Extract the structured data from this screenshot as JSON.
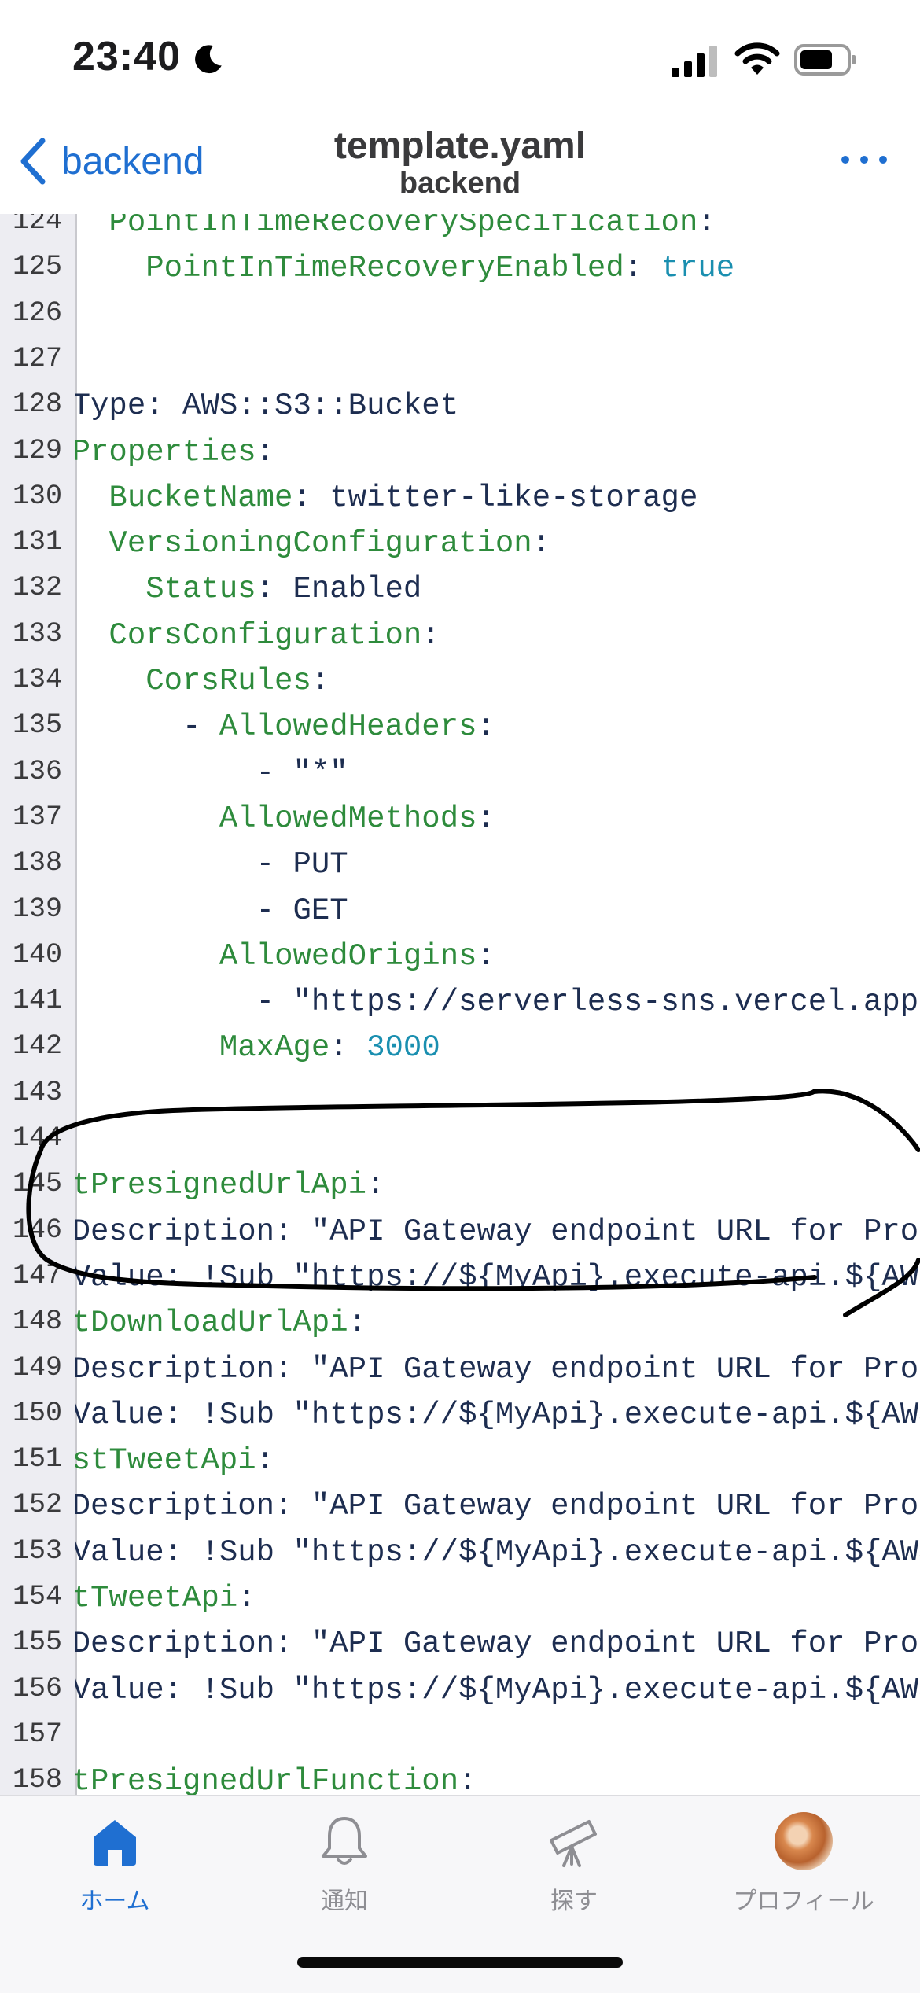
{
  "status_bar": {
    "time": "23:40"
  },
  "nav": {
    "back_label": "backend",
    "title": "template.yaml",
    "subtitle": "backend"
  },
  "code_lines": [
    {
      "num": "124",
      "tokens": [
        {
          "t": "      PointInTimeRecoverySpecification",
          "c": "k"
        },
        {
          "t": ":",
          "c": ""
        }
      ]
    },
    {
      "num": "125",
      "tokens": [
        {
          "t": "        PointInTimeRecoveryEnabled",
          "c": "k"
        },
        {
          "t": ": ",
          "c": ""
        },
        {
          "t": "true",
          "c": "v"
        }
      ]
    },
    {
      "num": "126",
      "tokens": []
    },
    {
      "num": "127",
      "tokens": []
    },
    {
      "num": "128",
      "tokens": [
        {
          "t": "    Type: AWS::S3::Bucket",
          "c": ""
        }
      ]
    },
    {
      "num": "129",
      "tokens": [
        {
          "t": "    Properties",
          "c": "k"
        },
        {
          "t": ":",
          "c": ""
        }
      ]
    },
    {
      "num": "130",
      "tokens": [
        {
          "t": "      BucketName",
          "c": "k"
        },
        {
          "t": ": twitter-like-storage",
          "c": ""
        }
      ]
    },
    {
      "num": "131",
      "tokens": [
        {
          "t": "      VersioningConfiguration",
          "c": "k"
        },
        {
          "t": ":",
          "c": ""
        }
      ]
    },
    {
      "num": "132",
      "tokens": [
        {
          "t": "        Status",
          "c": "k"
        },
        {
          "t": ": Enabled",
          "c": ""
        }
      ]
    },
    {
      "num": "133",
      "tokens": [
        {
          "t": "      CorsConfiguration",
          "c": "k"
        },
        {
          "t": ":",
          "c": ""
        }
      ]
    },
    {
      "num": "134",
      "tokens": [
        {
          "t": "        CorsRules",
          "c": "k"
        },
        {
          "t": ":",
          "c": ""
        }
      ]
    },
    {
      "num": "135",
      "tokens": [
        {
          "t": "          - ",
          "c": ""
        },
        {
          "t": "AllowedHeaders",
          "c": "k"
        },
        {
          "t": ":",
          "c": ""
        }
      ]
    },
    {
      "num": "136",
      "tokens": [
        {
          "t": "              - \"*\"",
          "c": ""
        }
      ]
    },
    {
      "num": "137",
      "tokens": [
        {
          "t": "            ",
          "c": ""
        },
        {
          "t": "AllowedMethods",
          "c": "k"
        },
        {
          "t": ":",
          "c": ""
        }
      ]
    },
    {
      "num": "138",
      "tokens": [
        {
          "t": "              - PUT",
          "c": ""
        }
      ]
    },
    {
      "num": "139",
      "tokens": [
        {
          "t": "              - GET",
          "c": ""
        }
      ]
    },
    {
      "num": "140",
      "tokens": [
        {
          "t": "            ",
          "c": ""
        },
        {
          "t": "AllowedOrigins",
          "c": "k"
        },
        {
          "t": ":",
          "c": ""
        }
      ]
    },
    {
      "num": "141",
      "tokens": [
        {
          "t": "              - \"https://serverless-sns.vercel.app\"",
          "c": ""
        }
      ]
    },
    {
      "num": "142",
      "tokens": [
        {
          "t": "            ",
          "c": ""
        },
        {
          "t": "MaxAge",
          "c": "k"
        },
        {
          "t": ": ",
          "c": ""
        },
        {
          "t": "3000",
          "c": "v"
        }
      ]
    },
    {
      "num": "143",
      "tokens": []
    },
    {
      "num": "144",
      "tokens": []
    },
    {
      "num": "145",
      "tokens": [
        {
          "t": "  GetPresignedUrlApi",
          "c": "k"
        },
        {
          "t": ":",
          "c": ""
        }
      ]
    },
    {
      "num": "146",
      "tokens": [
        {
          "t": "    Description: \"API Gateway endpoint URL for Prod stage",
          "c": ""
        }
      ]
    },
    {
      "num": "147",
      "tokens": [
        {
          "t": "    Value: !Sub \"https://${MyApi}.execute-api.${AWS::Region",
          "c": ""
        }
      ]
    },
    {
      "num": "148",
      "tokens": [
        {
          "t": "  GetDownloadUrlApi",
          "c": "k"
        },
        {
          "t": ":",
          "c": ""
        }
      ]
    },
    {
      "num": "149",
      "tokens": [
        {
          "t": "    Description: \"API Gateway endpoint URL for Prod stage",
          "c": ""
        }
      ]
    },
    {
      "num": "150",
      "tokens": [
        {
          "t": "    Value: !Sub \"https://${MyApi}.execute-api.${AWS::Region",
          "c": ""
        }
      ]
    },
    {
      "num": "151",
      "tokens": [
        {
          "t": "  PostTweetApi",
          "c": "k"
        },
        {
          "t": ":",
          "c": ""
        }
      ]
    },
    {
      "num": "152",
      "tokens": [
        {
          "t": "    Description: \"API Gateway endpoint URL for Prod stage",
          "c": ""
        }
      ]
    },
    {
      "num": "153",
      "tokens": [
        {
          "t": "    Value: !Sub \"https://${MyApi}.execute-api.${AWS::Region",
          "c": ""
        }
      ]
    },
    {
      "num": "154",
      "tokens": [
        {
          "t": "  GetTweetApi",
          "c": "k"
        },
        {
          "t": ":",
          "c": ""
        }
      ]
    },
    {
      "num": "155",
      "tokens": [
        {
          "t": "    Description: \"API Gateway endpoint URL for Prod stage",
          "c": ""
        }
      ]
    },
    {
      "num": "156",
      "tokens": [
        {
          "t": "    Value: !Sub \"https://${MyApi}.execute-api.${AWS::Region",
          "c": ""
        }
      ]
    },
    {
      "num": "157",
      "tokens": []
    },
    {
      "num": "158",
      "tokens": [
        {
          "t": "  GetPresignedUrlFunction",
          "c": "k"
        },
        {
          "t": ":",
          "c": ""
        }
      ]
    }
  ],
  "tabs": [
    {
      "label": "ホーム",
      "icon": "home-icon",
      "active": true
    },
    {
      "label": "通知",
      "icon": "bell-icon",
      "active": false
    },
    {
      "label": "探す",
      "icon": "telescope-icon",
      "active": false
    },
    {
      "label": "プロフィール",
      "icon": "avatar",
      "active": false
    }
  ],
  "colors": {
    "accent": "#1f6fd1",
    "key": "#2e8b3c",
    "value": "#1a8fb0",
    "text": "#1d2d50"
  }
}
